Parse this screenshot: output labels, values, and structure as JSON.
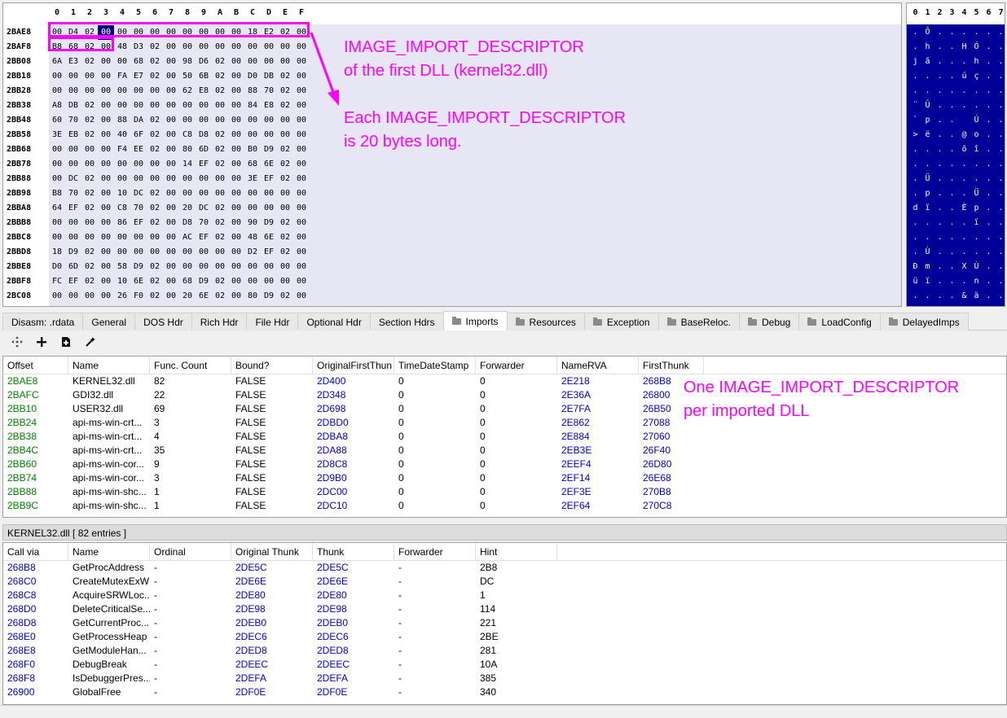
{
  "hex": {
    "header": [
      "0",
      "1",
      "2",
      "3",
      "4",
      "5",
      "6",
      "7",
      "8",
      "9",
      "A",
      "B",
      "C",
      "D",
      "E",
      "F"
    ],
    "rows": [
      {
        "offset": "2BAE8",
        "bytes": [
          "00",
          "D4",
          "02",
          "00",
          "00",
          "00",
          "00",
          "00",
          "00",
          "00",
          "00",
          "00",
          "18",
          "E2",
          "02",
          "00"
        ]
      },
      {
        "offset": "2BAF8",
        "bytes": [
          "B8",
          "68",
          "02",
          "00",
          "48",
          "D3",
          "02",
          "00",
          "00",
          "00",
          "00",
          "00",
          "00",
          "00",
          "00",
          "00"
        ]
      },
      {
        "offset": "2BB08",
        "bytes": [
          "6A",
          "E3",
          "02",
          "00",
          "00",
          "68",
          "02",
          "00",
          "98",
          "D6",
          "02",
          "00",
          "00",
          "00",
          "00",
          "00"
        ]
      },
      {
        "offset": "2BB18",
        "bytes": [
          "00",
          "00",
          "00",
          "00",
          "FA",
          "E7",
          "02",
          "00",
          "50",
          "6B",
          "02",
          "00",
          "D0",
          "DB",
          "02",
          "00"
        ]
      },
      {
        "offset": "2BB28",
        "bytes": [
          "00",
          "00",
          "00",
          "00",
          "00",
          "00",
          "00",
          "00",
          "62",
          "E8",
          "02",
          "00",
          "88",
          "70",
          "02",
          "00"
        ]
      },
      {
        "offset": "2BB38",
        "bytes": [
          "A8",
          "DB",
          "02",
          "00",
          "00",
          "00",
          "00",
          "00",
          "00",
          "00",
          "00",
          "00",
          "84",
          "E8",
          "02",
          "00"
        ]
      },
      {
        "offset": "2BB48",
        "bytes": [
          "60",
          "70",
          "02",
          "00",
          "88",
          "DA",
          "02",
          "00",
          "00",
          "00",
          "00",
          "00",
          "00",
          "00",
          "00",
          "00"
        ]
      },
      {
        "offset": "2BB58",
        "bytes": [
          "3E",
          "EB",
          "02",
          "00",
          "40",
          "6F",
          "02",
          "00",
          "C8",
          "D8",
          "02",
          "00",
          "00",
          "00",
          "00",
          "00"
        ]
      },
      {
        "offset": "2BB68",
        "bytes": [
          "00",
          "00",
          "00",
          "00",
          "F4",
          "EE",
          "02",
          "00",
          "80",
          "6D",
          "02",
          "00",
          "B0",
          "D9",
          "02",
          "00"
        ]
      },
      {
        "offset": "2BB78",
        "bytes": [
          "00",
          "00",
          "00",
          "00",
          "00",
          "00",
          "00",
          "00",
          "14",
          "EF",
          "02",
          "00",
          "68",
          "6E",
          "02",
          "00"
        ]
      },
      {
        "offset": "2BB88",
        "bytes": [
          "00",
          "DC",
          "02",
          "00",
          "00",
          "00",
          "00",
          "00",
          "00",
          "00",
          "00",
          "00",
          "3E",
          "EF",
          "02",
          "00"
        ]
      },
      {
        "offset": "2BB98",
        "bytes": [
          "B8",
          "70",
          "02",
          "00",
          "10",
          "DC",
          "02",
          "00",
          "00",
          "00",
          "00",
          "00",
          "00",
          "00",
          "00",
          "00"
        ]
      },
      {
        "offset": "2BBA8",
        "bytes": [
          "64",
          "EF",
          "02",
          "00",
          "C8",
          "70",
          "02",
          "00",
          "20",
          "DC",
          "02",
          "00",
          "00",
          "00",
          "00",
          "00"
        ]
      },
      {
        "offset": "2BBB8",
        "bytes": [
          "00",
          "00",
          "00",
          "00",
          "86",
          "EF",
          "02",
          "00",
          "D8",
          "70",
          "02",
          "00",
          "90",
          "D9",
          "02",
          "00"
        ]
      },
      {
        "offset": "2BBC8",
        "bytes": [
          "00",
          "00",
          "00",
          "00",
          "00",
          "00",
          "00",
          "00",
          "AC",
          "EF",
          "02",
          "00",
          "48",
          "6E",
          "02",
          "00"
        ]
      },
      {
        "offset": "2BBD8",
        "bytes": [
          "18",
          "D9",
          "02",
          "00",
          "00",
          "00",
          "00",
          "00",
          "00",
          "00",
          "00",
          "00",
          "D2",
          "EF",
          "02",
          "00"
        ]
      },
      {
        "offset": "2BBE8",
        "bytes": [
          "D0",
          "6D",
          "02",
          "00",
          "58",
          "D9",
          "02",
          "00",
          "00",
          "00",
          "00",
          "00",
          "00",
          "00",
          "00",
          "00"
        ]
      },
      {
        "offset": "2BBF8",
        "bytes": [
          "FC",
          "EF",
          "02",
          "00",
          "10",
          "6E",
          "02",
          "00",
          "68",
          "D9",
          "02",
          "00",
          "00",
          "00",
          "00",
          "00"
        ]
      },
      {
        "offset": "2BC08",
        "bytes": [
          "00",
          "00",
          "00",
          "00",
          "26",
          "F0",
          "02",
          "00",
          "20",
          "6E",
          "02",
          "00",
          "80",
          "D9",
          "02",
          "00"
        ]
      }
    ]
  },
  "ascii": {
    "header": [
      "0",
      "1",
      "2",
      "3",
      "4",
      "5",
      "6",
      "7"
    ],
    "rows": [
      [
        ".",
        "Ô",
        ".",
        ".",
        ".",
        ".",
        ".",
        "."
      ],
      [
        ".",
        "h",
        ".",
        ".",
        "H",
        "Ó",
        ".",
        "."
      ],
      [
        "j",
        "ã",
        ".",
        ".",
        ".",
        "h",
        ".",
        "."
      ],
      [
        ".",
        ".",
        ".",
        ".",
        "ú",
        "ç",
        ".",
        "."
      ],
      [
        ".",
        ".",
        ".",
        ".",
        ".",
        ".",
        ".",
        "."
      ],
      [
        "¨",
        "Û",
        ".",
        ".",
        ".",
        ".",
        ".",
        "."
      ],
      [
        "`",
        "p",
        ".",
        ".",
        "",
        "Ú",
        ".",
        "."
      ],
      [
        ">",
        "ë",
        ".",
        ".",
        "@",
        "o",
        ".",
        "."
      ],
      [
        ".",
        ".",
        ".",
        ".",
        "ô",
        "î",
        ".",
        "."
      ],
      [
        ".",
        ".",
        ".",
        ".",
        ".",
        ".",
        ".",
        "."
      ],
      [
        ".",
        "Ü",
        ".",
        ".",
        ".",
        ".",
        ".",
        "."
      ],
      [
        ".",
        "p",
        ".",
        ".",
        ".",
        "Ü",
        ".",
        "."
      ],
      [
        "d",
        "ï",
        ".",
        ".",
        "È",
        "p",
        ".",
        "."
      ],
      [
        ".",
        ".",
        ".",
        ".",
        ".",
        "ï",
        ".",
        "."
      ],
      [
        ".",
        ".",
        ".",
        ".",
        ".",
        ".",
        ".",
        "."
      ],
      [
        ".",
        "Ù",
        ".",
        ".",
        ".",
        ".",
        ".",
        "."
      ],
      [
        "Ð",
        "m",
        ".",
        ".",
        "X",
        "Ù",
        ".",
        "."
      ],
      [
        "ü",
        "ï",
        ".",
        ".",
        ".",
        "n",
        ".",
        "."
      ],
      [
        ".",
        ".",
        ".",
        ".",
        "&",
        "ä",
        ".",
        "."
      ]
    ]
  },
  "annotations": {
    "descriptor_title": "IMAGE_IMPORT_DESCRIPTOR\nof the first DLL (kernel32.dll)",
    "descriptor_size": "Each IMAGE_IMPORT_DESCRIPTOR\nis 20 bytes long.",
    "per_dll": "One IMAGE_IMPORT_DESCRIPTOR\nper imported DLL"
  },
  "colors": {
    "annotation": "#ff00ff",
    "selection": "#000080",
    "offset_green": "#008000",
    "link_blue": "#0000cc"
  },
  "tabs": [
    {
      "label": "Disasm: .rdata",
      "folder": false
    },
    {
      "label": "General",
      "folder": false
    },
    {
      "label": "DOS Hdr",
      "folder": false
    },
    {
      "label": "Rich Hdr",
      "folder": false
    },
    {
      "label": "File Hdr",
      "folder": false
    },
    {
      "label": "Optional Hdr",
      "folder": false
    },
    {
      "label": "Section Hdrs",
      "folder": false
    },
    {
      "label": "Imports",
      "folder": true,
      "active": true
    },
    {
      "label": "Resources",
      "folder": true
    },
    {
      "label": "Exception",
      "folder": true
    },
    {
      "label": "BaseReloc.",
      "folder": true
    },
    {
      "label": "Debug",
      "folder": true
    },
    {
      "label": "LoadConfig",
      "folder": true
    },
    {
      "label": "DelayedImps",
      "folder": true
    }
  ],
  "toolbar": [
    "move-icon",
    "add-icon",
    "add-file-icon",
    "wand-icon"
  ],
  "imports": {
    "columns": [
      "Offset",
      "Name",
      "Func. Count",
      "Bound?",
      "OriginalFirstThun",
      "TimeDateStamp",
      "Forwarder",
      "NameRVA",
      "FirstThunk"
    ],
    "rows": [
      [
        "2BAE8",
        "KERNEL32.dll",
        "82",
        "FALSE",
        "2D400",
        "0",
        "0",
        "2E218",
        "268B8"
      ],
      [
        "2BAFC",
        "GDI32.dll",
        "22",
        "FALSE",
        "2D348",
        "0",
        "0",
        "2E36A",
        "26800"
      ],
      [
        "2BB10",
        "USER32.dll",
        "69",
        "FALSE",
        "2D698",
        "0",
        "0",
        "2E7FA",
        "26B50"
      ],
      [
        "2BB24",
        "api-ms-win-crt...",
        "3",
        "FALSE",
        "2DBD0",
        "0",
        "0",
        "2E862",
        "27088"
      ],
      [
        "2BB38",
        "api-ms-win-crt...",
        "4",
        "FALSE",
        "2DBA8",
        "0",
        "0",
        "2E884",
        "27060"
      ],
      [
        "2BB4C",
        "api-ms-win-crt...",
        "35",
        "FALSE",
        "2DA88",
        "0",
        "0",
        "2EB3E",
        "26F40"
      ],
      [
        "2BB60",
        "api-ms-win-cor...",
        "9",
        "FALSE",
        "2D8C8",
        "0",
        "0",
        "2EEF4",
        "26D80"
      ],
      [
        "2BB74",
        "api-ms-win-cor...",
        "3",
        "FALSE",
        "2D9B0",
        "0",
        "0",
        "2EF14",
        "26E68"
      ],
      [
        "2BB88",
        "api-ms-win-shc...",
        "1",
        "FALSE",
        "2DC00",
        "0",
        "0",
        "2EF3E",
        "270B8"
      ],
      [
        "2BB9C",
        "api-ms-win-shc...",
        "1",
        "FALSE",
        "2DC10",
        "0",
        "0",
        "2EF64",
        "270C8"
      ]
    ]
  },
  "dll_status": "KERNEL32.dll   [ 82 entries ]",
  "functions": {
    "columns": [
      "Call via",
      "Name",
      "Ordinal",
      "Original Thunk",
      "Thunk",
      "Forwarder",
      "Hint"
    ],
    "rows": [
      [
        "268B8",
        "GetProcAddress",
        "-",
        "2DE5C",
        "2DE5C",
        "-",
        "2B8"
      ],
      [
        "268C0",
        "CreateMutexExW",
        "-",
        "2DE6E",
        "2DE6E",
        "-",
        "DC"
      ],
      [
        "268C8",
        "AcquireSRWLoc...",
        "-",
        "2DE80",
        "2DE80",
        "-",
        "1"
      ],
      [
        "268D0",
        "DeleteCriticalSe...",
        "-",
        "2DE98",
        "2DE98",
        "-",
        "114"
      ],
      [
        "268D8",
        "GetCurrentProc...",
        "-",
        "2DEB0",
        "2DEB0",
        "-",
        "221"
      ],
      [
        "268E0",
        "GetProcessHeap",
        "-",
        "2DEC6",
        "2DEC6",
        "-",
        "2BE"
      ],
      [
        "268E8",
        "GetModuleHan...",
        "-",
        "2DED8",
        "2DED8",
        "-",
        "281"
      ],
      [
        "268F0",
        "DebugBreak",
        "-",
        "2DEEC",
        "2DEEC",
        "-",
        "10A"
      ],
      [
        "268F8",
        "IsDebuggerPres...",
        "-",
        "2DEFA",
        "2DEFA",
        "-",
        "385"
      ],
      [
        "26900",
        "GlobalFree",
        "-",
        "2DF0E",
        "2DF0E",
        "-",
        "340"
      ]
    ]
  }
}
